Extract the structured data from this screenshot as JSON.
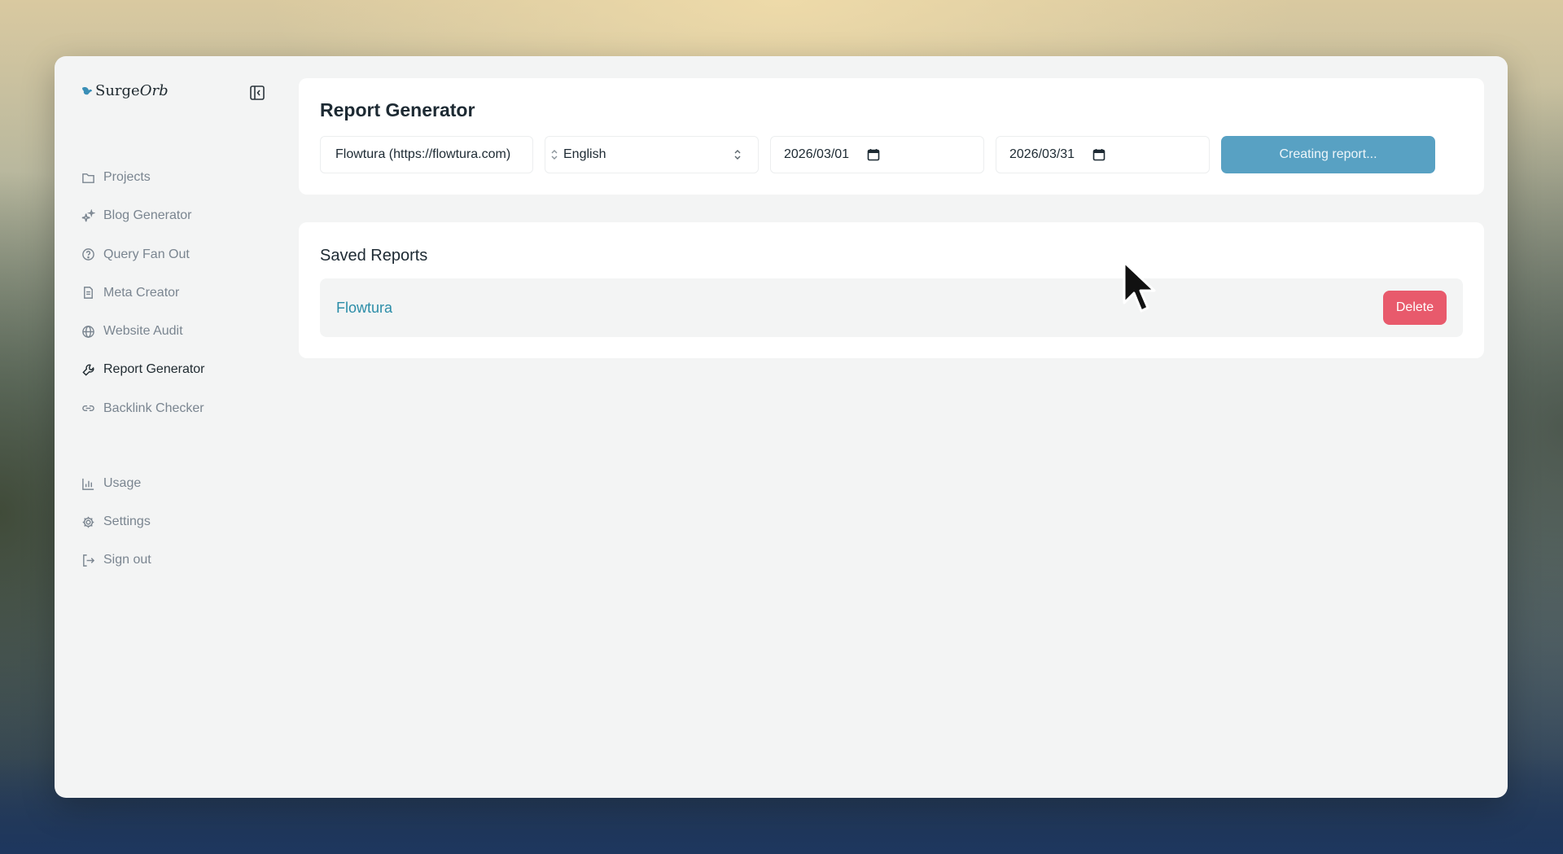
{
  "brand": {
    "name_plain": "Surge",
    "name_italic": "Orb",
    "logo_icon": "wing-icon"
  },
  "sidebar": {
    "collapse_icon": "sidebar-collapse-icon",
    "items": [
      {
        "label": "Projects",
        "icon": "folder-icon"
      },
      {
        "label": "Blog Generator",
        "icon": "sparkles-icon"
      },
      {
        "label": "Query Fan Out",
        "icon": "question-circle-icon"
      },
      {
        "label": "Meta Creator",
        "icon": "document-icon"
      },
      {
        "label": "Website Audit",
        "icon": "globe-icon"
      },
      {
        "label": "Report Generator",
        "icon": "wrench-icon",
        "active": true
      },
      {
        "label": "Backlink Checker",
        "icon": "link-icon"
      }
    ],
    "footer_items": [
      {
        "label": "Usage",
        "icon": "bar-chart-icon"
      },
      {
        "label": "Settings",
        "icon": "gear-icon"
      },
      {
        "label": "Sign out",
        "icon": "sign-out-icon"
      }
    ]
  },
  "report_generator": {
    "title": "Report Generator",
    "project_select": "Flowtura (https://flowtura.com)",
    "language_select": "English",
    "start_date": "2026/03/01",
    "end_date": "2026/03/31",
    "create_button": "Creating report..."
  },
  "saved_reports": {
    "title": "Saved Reports",
    "items": [
      {
        "name": "Flowtura",
        "delete_label": "Delete"
      }
    ]
  },
  "colors": {
    "accent": "#58a1c3",
    "link": "#2b8da8",
    "danger": "#e85a6c",
    "window_bg": "#f3f4f4"
  }
}
